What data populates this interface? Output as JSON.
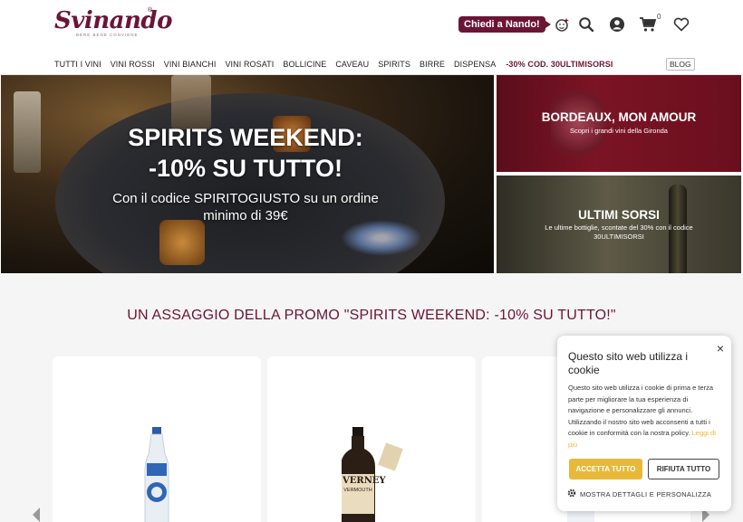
{
  "header": {
    "logo_text": "Svinando",
    "logo_reg": "®",
    "logo_tagline": "BERE BENE CONVIENE",
    "chat_label": "Chiedi a Nando!",
    "cart_count": "0",
    "icons": [
      "sommelier-icon",
      "search-icon",
      "account-icon",
      "cart-icon",
      "heart-icon"
    ]
  },
  "nav": {
    "items": [
      "TUTTI I VINI",
      "VINI ROSSI",
      "VINI BIANCHI",
      "VINI ROSATI",
      "BOLLICINE",
      "CAVEAU",
      "SPIRITS",
      "BIRRE",
      "DISPENSA"
    ],
    "promo": "-30% COD. 30ULTIMISORSI",
    "blog": "BLOG"
  },
  "hero": {
    "title_line1": "SPIRITS WEEKEND:",
    "title_line2": "-10% SU TUTTO!",
    "subtitle": "Con il codice SPIRITOGIUSTO su un ordine minimo di 39€"
  },
  "banners": [
    {
      "title": "BORDEAUX, MON AMOUR",
      "subtitle": "Scopri i grandi vini della Gironda"
    },
    {
      "title": "ULTIMI SORSI",
      "subtitle": "Le ultime bottiglie, scontate del 30% con il codice 30ULTIMISORSI"
    }
  ],
  "promo_section": {
    "title": "UN ASSAGGIO DELLA PROMO \"SPIRITS WEEKEND: -10% SU TUTTO!\""
  },
  "products": {
    "card2_label": "VERNEY",
    "card2_sublabel": "VERMOUTH"
  },
  "cookie": {
    "title": "Questo sito web utilizza i cookie",
    "body": "Questo sito web utilizza i cookie di prima e terza parte per migliorare la tua esperienza di navigazione e personalizzare gli annunci. Utilizzando il nostro sito web acconsenti a tutti i cookie in conformità con la nostra policy.",
    "link": "Leggi di più",
    "accept": "ACCETTA TUTTO",
    "reject": "RIFIUTA TUTTO",
    "details": "MOSTRA DETTAGLI E PERSONALIZZA",
    "close": "×"
  },
  "colors": {
    "brand": "#6b1535",
    "accent": "#e8b839"
  }
}
